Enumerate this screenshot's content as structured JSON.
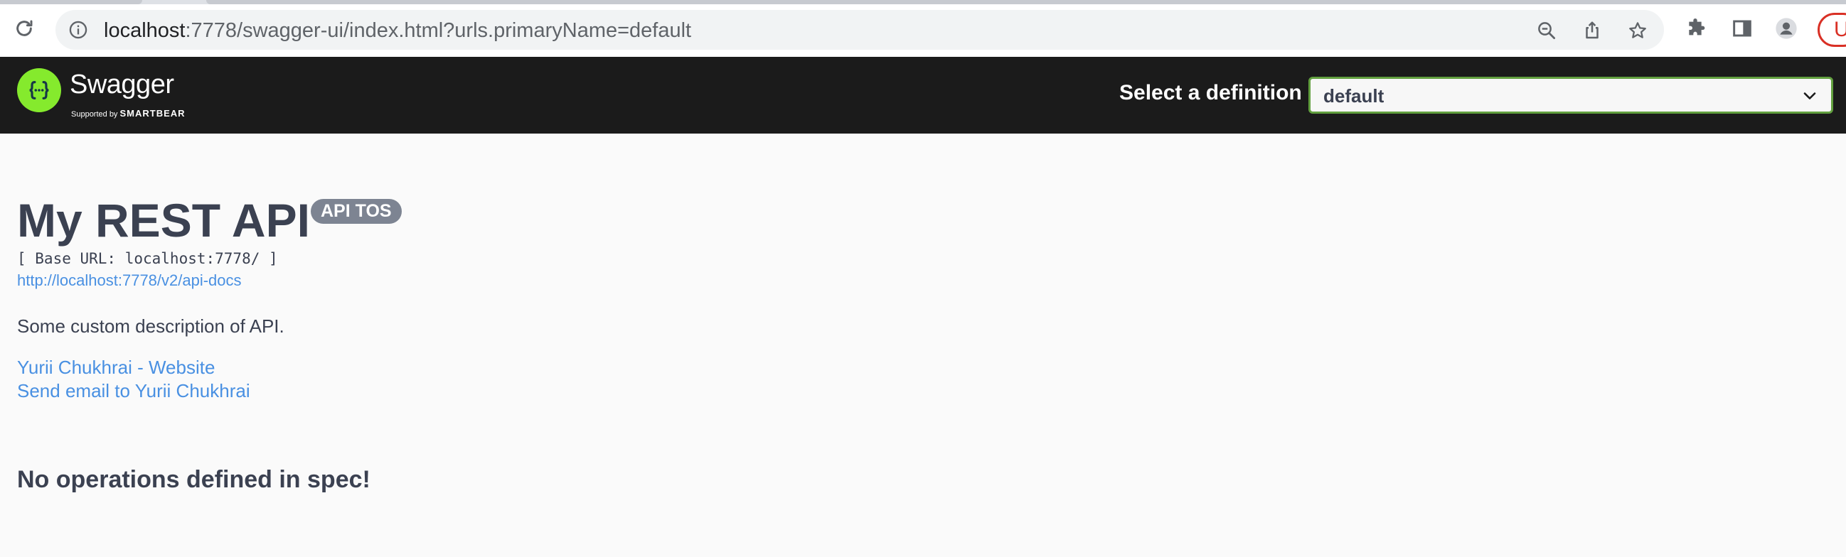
{
  "browser": {
    "url_host": "localhost",
    "url_path": ":7778/swagger-ui/index.html?urls.primaryName=default",
    "profile_initial": "U"
  },
  "topbar": {
    "logo_name": "Swagger",
    "logo_sub_prefix": "Supported by",
    "logo_sub_brand": "SMARTBEAR",
    "select_label": "Select a definition",
    "selected_definition": "default"
  },
  "info": {
    "title": "My REST API",
    "badge": "API TOS",
    "base_url": "[ Base URL: localhost:7778/ ]",
    "api_docs_link": "http://localhost:7778/v2/api-docs",
    "description": "Some custom description of API.",
    "contact_website": "Yurii Chukhrai - Website",
    "contact_email": "Send email to Yurii Chukhrai"
  },
  "operations": {
    "empty_message": "No operations defined in spec!"
  },
  "colors": {
    "topbar_bg": "#1b1b1b",
    "logo_green": "#85ea2d",
    "select_border": "#62a03f",
    "link": "#4990e2",
    "text": "#3b4151",
    "badge_bg": "#7d8492"
  }
}
